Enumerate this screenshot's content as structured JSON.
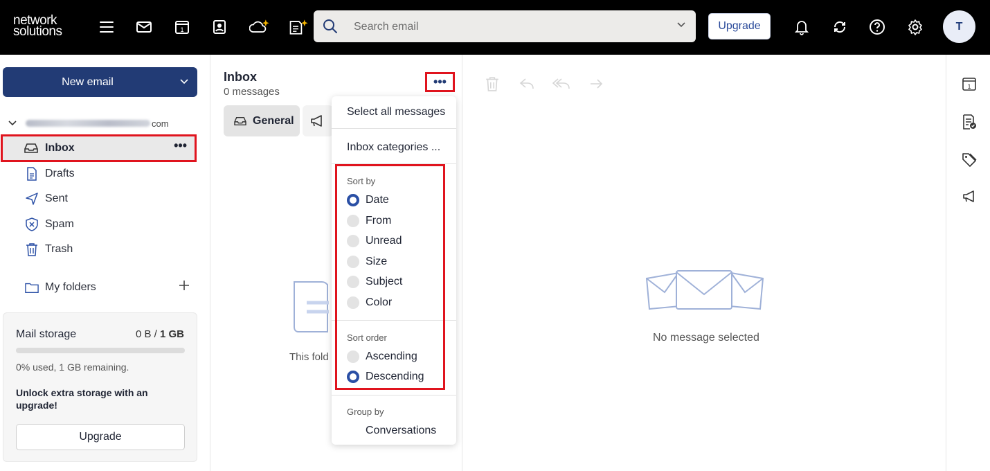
{
  "logo": {
    "line1": "network",
    "line2": "solutions"
  },
  "topbar": {
    "search_placeholder": "Search email",
    "upgrade_label": "Upgrade",
    "avatar_initial": "T"
  },
  "sidebar": {
    "new_email_label": "New email",
    "account_domain": "com",
    "folders": {
      "inbox": "Inbox",
      "drafts": "Drafts",
      "sent": "Sent",
      "spam": "Spam",
      "trash": "Trash",
      "my_folders": "My folders"
    },
    "more_glyph": "•••"
  },
  "storage": {
    "title": "Mail storage",
    "used": "0 B",
    "separator": " / ",
    "total": "1 GB",
    "used_fraction": 0,
    "summary": "0% used, 1 GB remaining.",
    "unlock_text": "Unlock extra storage with an upgrade!",
    "upgrade_label": "Upgrade"
  },
  "message_list": {
    "title": "Inbox",
    "count": "0 messages",
    "more_glyph": "•••",
    "tab_general": "General",
    "empty_text": "This fold"
  },
  "menu": {
    "select_all": "Select all messages",
    "inbox_categories": "Inbox categories ...",
    "sort_by_label": "Sort by",
    "sort_by_options": [
      "Date",
      "From",
      "Unread",
      "Size",
      "Subject",
      "Color"
    ],
    "sort_by_selected": "Date",
    "sort_order_label": "Sort order",
    "sort_order_options": [
      "Ascending",
      "Descending"
    ],
    "sort_order_selected": "Descending",
    "group_by_label": "Group by",
    "group_by_value": "Conversations"
  },
  "reading_pane": {
    "empty_text": "No message selected"
  },
  "colors": {
    "topbar": "#000000",
    "primary": "#223b75",
    "highlight": "#e0141e",
    "radio_on": "#2a4fa5"
  }
}
